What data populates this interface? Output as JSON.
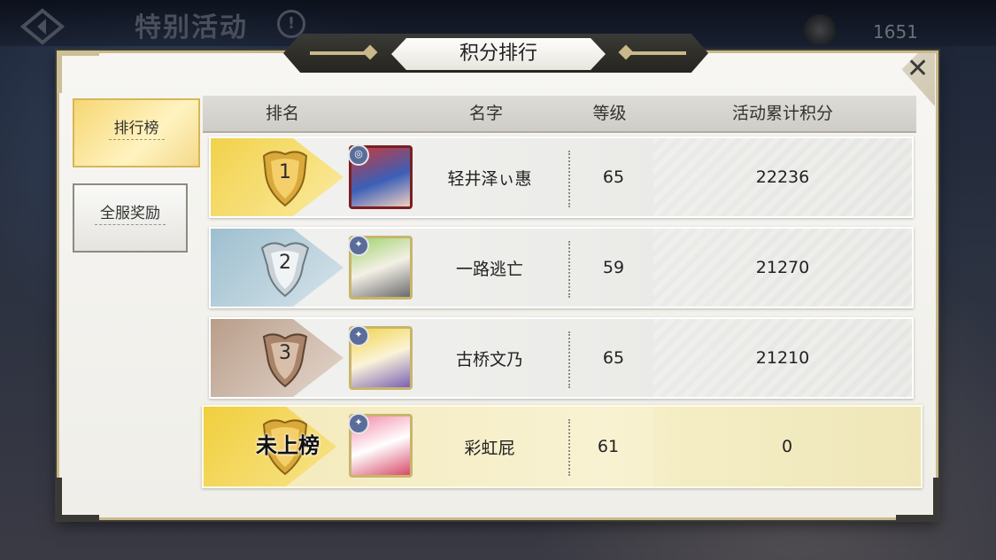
{
  "topbar": {
    "title": "特别活动",
    "info_glyph": "!",
    "currency_icon": "token-icon",
    "currency_value": "1651"
  },
  "panel": {
    "title": "积分排行",
    "close_glyph": "✕"
  },
  "tabs": [
    {
      "label": "排行榜",
      "active": true
    },
    {
      "label": "全服奖励",
      "active": false
    }
  ],
  "table": {
    "headers": {
      "rank": "排名",
      "name": "名字",
      "level": "等级",
      "score": "活动累计积分"
    },
    "rows": [
      {
        "rank": "1",
        "name": "轻井泽ぃ惠",
        "level": "65",
        "score": "22236",
        "medal": "gold-medal-icon"
      },
      {
        "rank": "2",
        "name": "一路逃亡",
        "level": "59",
        "score": "21270",
        "medal": "silver-medal-icon"
      },
      {
        "rank": "3",
        "name": "古桥文乃",
        "level": "65",
        "score": "21210",
        "medal": "bronze-medal-icon"
      }
    ],
    "self_row": {
      "rank": "未上榜",
      "name": "彩虹屁",
      "level": "61",
      "score": "0"
    }
  },
  "colors": {
    "accent_gold": "#f1d24b",
    "silver": "#9ebfcf",
    "bronze": "#b99e8a",
    "frame": "#c9b98a"
  }
}
